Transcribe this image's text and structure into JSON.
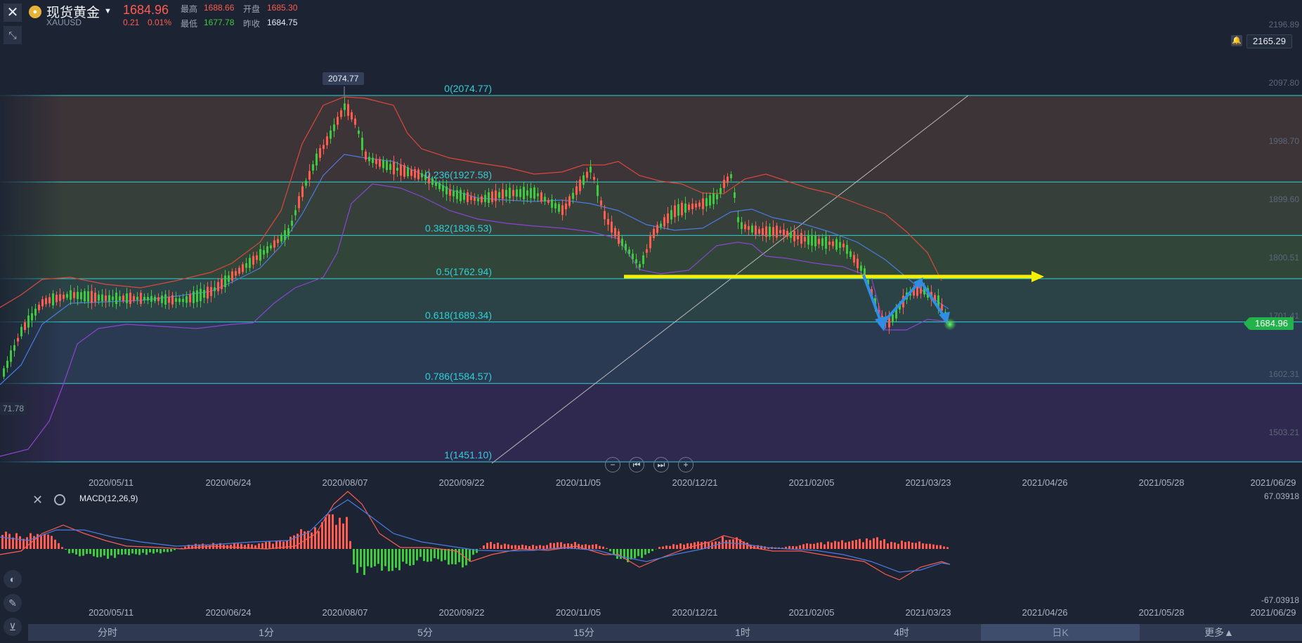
{
  "header": {
    "symbol_name": "现货黄金",
    "symbol_code": "XAUUSD",
    "coin_glyph": "●",
    "last_price": "1684.96",
    "change": "0.21",
    "change_pct": "0.01%",
    "high_label": "最高",
    "high_value": "1688.66",
    "open_label": "开盘",
    "open_value": "1685.30",
    "low_label": "最低",
    "low_value": "1677.78",
    "prev_label": "昨收",
    "prev_value": "1684.75"
  },
  "colors": {
    "up": "#ff5b4f",
    "down": "#3ec93e",
    "fib_line": "#2fd0d6",
    "price_tag": "#22b34a",
    "arrow_yellow": "#f6f000",
    "arrow_blue": "#2f8de4"
  },
  "icons": [
    "close-icon",
    "collapse-icon",
    "bell-icon",
    "indicator-icon",
    "pencil-icon",
    "measure-icon",
    "settings-icon"
  ],
  "price_axis": {
    "labels": [
      "2196.89",
      "2097.80",
      "1998.70",
      "1899.60",
      "1800.51",
      "1701.41",
      "1602.31",
      "1503.21"
    ],
    "alert_price": "2165.29",
    "current_tag": "1684.96",
    "left_edge_label": "71.78"
  },
  "peak_label": "2074.77",
  "fib_levels": [
    {
      "ratio": 0,
      "label": "0(2074.77)",
      "price": 2074.77
    },
    {
      "ratio": 0.236,
      "label": "0.236(1927.58)",
      "price": 1927.58
    },
    {
      "ratio": 0.382,
      "label": "0.382(1836.53)",
      "price": 1836.53
    },
    {
      "ratio": 0.5,
      "label": "0.5(1762.94)",
      "price": 1762.94
    },
    {
      "ratio": 0.618,
      "label": "0.618(1689.34)",
      "price": 1689.34
    },
    {
      "ratio": 0.786,
      "label": "0.786(1584.57)",
      "price": 1584.57
    },
    {
      "ratio": 1,
      "label": "1(1451.10)",
      "price": 1451.1
    }
  ],
  "dates": [
    "2020/05/11",
    "2020/06/24",
    "2020/08/07",
    "2020/09/22",
    "2020/11/05",
    "2020/12/21",
    "2021/02/05",
    "2021/03/23",
    "2021/04/26",
    "2021/05/28",
    "2021/06/29"
  ],
  "macd": {
    "title": "MACD(12,26,9)",
    "max": "67.03918",
    "min": "-67.03918"
  },
  "tabs": [
    "分时",
    "1分",
    "5分",
    "15分",
    "1时",
    "4时",
    "日K",
    "更多▲"
  ],
  "active_tab": "日K",
  "nav_buttons": [
    "−",
    "⏮",
    "⏭",
    "+"
  ]
}
